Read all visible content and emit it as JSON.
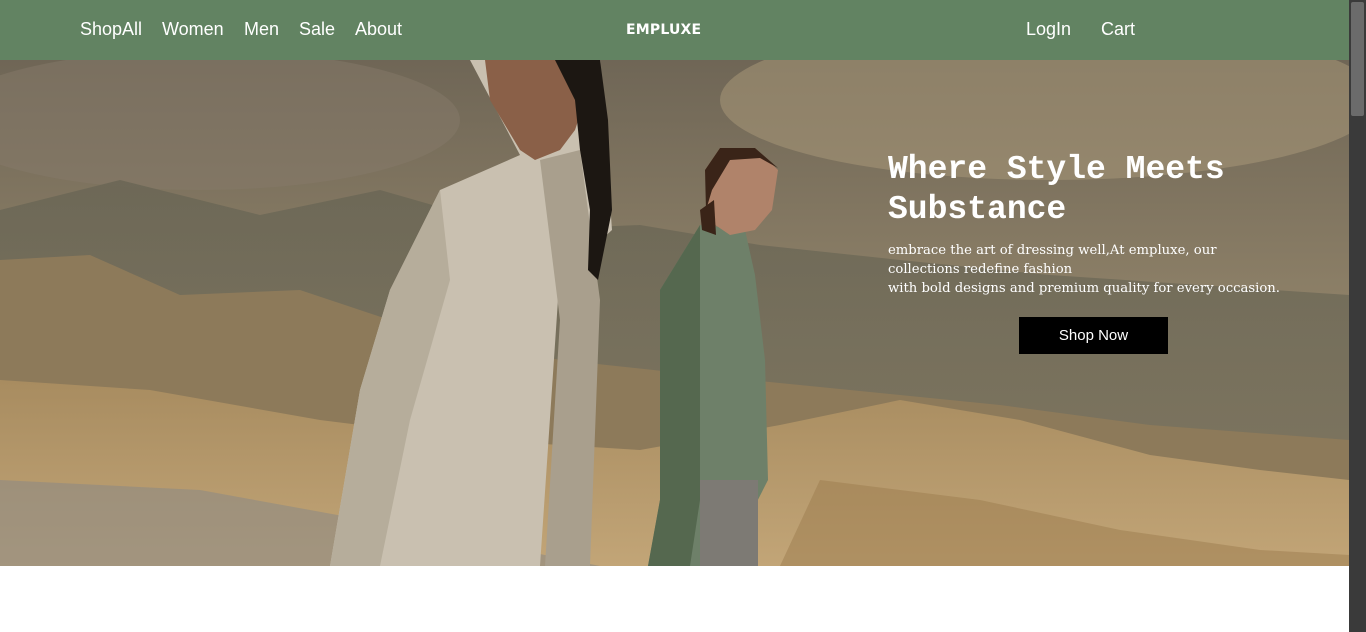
{
  "navbar": {
    "left_links": [
      "ShopAll",
      "Women",
      "Men",
      "Sale",
      "About"
    ],
    "brand": "EMPLUXE",
    "login": "LogIn",
    "cart": "Cart"
  },
  "hero": {
    "title": "Where Style Meets Substance",
    "description_lines": [
      "embrace the art of dressing well,At empluxe, our collections redefine fashion",
      "with bold designs and premium quality for every occasion."
    ],
    "button": "Shop Now"
  },
  "colors": {
    "navbar_bg": "#628362",
    "button_bg": "#000000",
    "text": "#ffffff"
  }
}
